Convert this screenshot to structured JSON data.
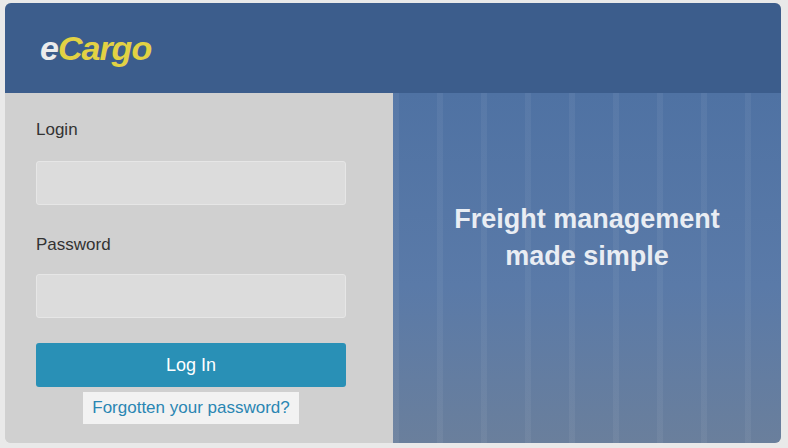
{
  "header": {
    "logo": {
      "prefix": "e",
      "name": "Cargo"
    }
  },
  "form": {
    "fields": [
      {
        "label": "Login",
        "value": "",
        "kind": "text"
      },
      {
        "label": "Password",
        "value": "",
        "kind": "password"
      }
    ],
    "button": "Log In",
    "link": "Forgotten your password?"
  },
  "banner": {
    "tagline": [
      "Freight management",
      "made simple"
    ]
  }
}
